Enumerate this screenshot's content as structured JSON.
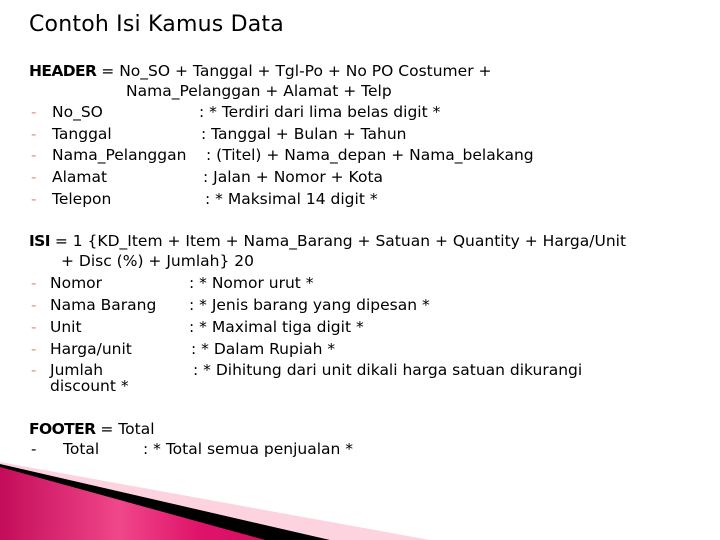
{
  "title": "Contoh Isi Kamus Data",
  "header": {
    "keyword": "HEADER",
    "definition_line1": "= No_SO + Tanggal + Tgl-Po + No PO Costumer +",
    "definition_line2": "Nama_Pelanggan + Alamat + Telp",
    "items": [
      {
        "bullet": "-",
        "name": "No_SO",
        "desc": ": * Terdiri dari lima belas digit *"
      },
      {
        "bullet": "-",
        "name": "Tanggal",
        "desc": ": Tanggal + Bulan + Tahun"
      },
      {
        "bullet": "-",
        "name": "Nama_Pelanggan",
        "desc": ": (Titel) + Nama_depan + Nama_belakang"
      },
      {
        "bullet": "-",
        "name": "Alamat",
        "desc": ": Jalan + Nomor + Kota"
      },
      {
        "bullet": "-",
        "name": "Telepon",
        "desc": ": * Maksimal 14 digit *"
      }
    ]
  },
  "isi": {
    "keyword": "ISI",
    "definition_line1": "= 1 {KD_Item + Item +  Nama_Barang + Satuan + Quantity + Harga/Unit",
    "definition_line2": "+ Disc (%) + Jumlah}  20",
    "items": [
      {
        "bullet": "-",
        "name": "Nomor",
        "desc": ": * Nomor urut *"
      },
      {
        "bullet": "-",
        "name": "Nama Barang",
        "desc": ": * Jenis barang yang dipesan *"
      },
      {
        "bullet": "-",
        "name": "Unit",
        "desc": ": * Maximal tiga digit *"
      },
      {
        "bullet": "-",
        "name": "Harga/unit",
        "desc": ": * Dalam Rupiah *"
      },
      {
        "bullet": "-",
        "name": "Jumlah",
        "desc": ": * Dihitung dari unit dikali harga satuan dikurangi",
        "continuation": "discount *"
      }
    ]
  },
  "footer": {
    "keyword": "FOOTER",
    "definition": "= Total",
    "items": [
      {
        "bullet": "-",
        "name": "Total",
        "desc": ": * Total semua penjualan *"
      }
    ]
  },
  "colors": {
    "bullet": "#d4957a",
    "accent_magenta": "#e0136a",
    "accent_pink_light": "#fcd3df"
  }
}
